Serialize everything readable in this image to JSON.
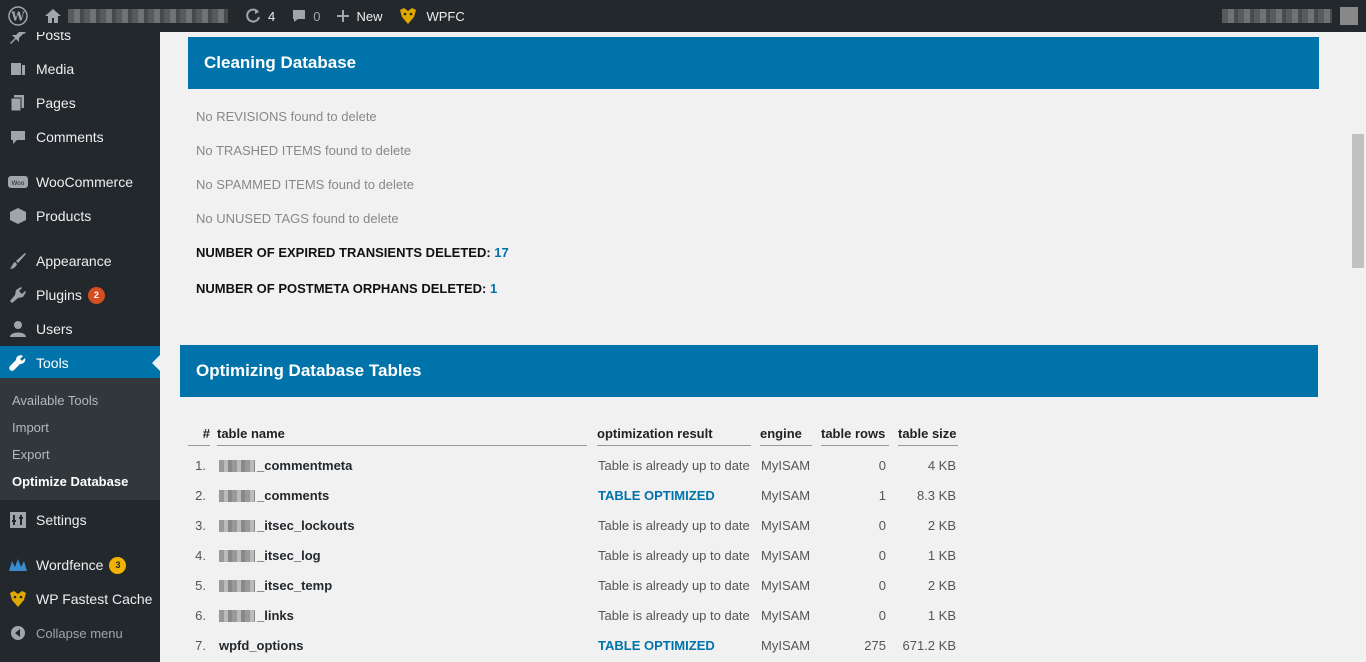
{
  "adminbar": {
    "updates_count": "4",
    "comments_count": "0",
    "new_label": "New",
    "wpfc_label": "WPFC"
  },
  "sidebar": {
    "items": [
      {
        "label": "Posts",
        "icon": "pin-icon"
      },
      {
        "label": "Media",
        "icon": "media-icon"
      },
      {
        "label": "Pages",
        "icon": "pages-icon"
      },
      {
        "label": "Comments",
        "icon": "comments-icon"
      },
      {
        "label": "WooCommerce",
        "icon": "woocommerce-icon"
      },
      {
        "label": "Products",
        "icon": "products-icon"
      },
      {
        "label": "Appearance",
        "icon": "brush-icon"
      },
      {
        "label": "Plugins",
        "icon": "plugins-icon",
        "badge": "2"
      },
      {
        "label": "Users",
        "icon": "users-icon"
      },
      {
        "label": "Tools",
        "icon": "wrench-icon"
      },
      {
        "label": "Settings",
        "icon": "settings-icon"
      },
      {
        "label": "Wordfence",
        "icon": "wordfence-icon",
        "badge": "3"
      },
      {
        "label": "WP Fastest Cache",
        "icon": "cheetah-icon"
      },
      {
        "label": "Collapse menu",
        "icon": "collapse-icon"
      }
    ],
    "submenu": [
      "Available Tools",
      "Import",
      "Export",
      "Optimize Database"
    ]
  },
  "cleaning": {
    "title": "Cleaning Database",
    "lines": [
      "No REVISIONS found to delete",
      "No TRASHED ITEMS found to delete",
      "No SPAMMED ITEMS found to delete",
      "No UNUSED TAGS found to delete"
    ],
    "stats": [
      {
        "label": "NUMBER OF EXPIRED TRANSIENTS DELETED: ",
        "value": "17"
      },
      {
        "label": "NUMBER OF POSTMETA ORPHANS DELETED: ",
        "value": "1"
      }
    ]
  },
  "optimizing": {
    "title": "Optimizing Database Tables",
    "headers": [
      "#",
      "table name",
      "optimization result",
      "engine",
      "table rows",
      "table size"
    ],
    "rows": [
      {
        "n": "1.",
        "name": "_commentmeta",
        "result": "Table is already up to date",
        "optimized": false,
        "engine": "MyISAM",
        "rows": "0",
        "size": "4 KB"
      },
      {
        "n": "2.",
        "name": "_comments",
        "result": "TABLE OPTIMIZED",
        "optimized": true,
        "engine": "MyISAM",
        "rows": "1",
        "size": "8.3 KB"
      },
      {
        "n": "3.",
        "name": "_itsec_lockouts",
        "result": "Table is already up to date",
        "optimized": false,
        "engine": "MyISAM",
        "rows": "0",
        "size": "2 KB"
      },
      {
        "n": "4.",
        "name": "_itsec_log",
        "result": "Table is already up to date",
        "optimized": false,
        "engine": "MyISAM",
        "rows": "0",
        "size": "1 KB"
      },
      {
        "n": "5.",
        "name": "_itsec_temp",
        "result": "Table is already up to date",
        "optimized": false,
        "engine": "MyISAM",
        "rows": "0",
        "size": "2 KB"
      },
      {
        "n": "6.",
        "name": "_links",
        "result": "Table is already up to date",
        "optimized": false,
        "engine": "MyISAM",
        "rows": "0",
        "size": "1 KB"
      },
      {
        "n": "7.",
        "name": "wpfd_options",
        "result": "TABLE OPTIMIZED",
        "optimized": true,
        "engine": "MyISAM",
        "rows": "275",
        "size": "671.2 KB"
      }
    ]
  },
  "colors": {
    "accent": "#0073aa",
    "sidebar_bg": "#23282d",
    "submenu_bg": "#32373c",
    "badge_red": "#d54e21",
    "badge_yellow": "#f0b400"
  }
}
